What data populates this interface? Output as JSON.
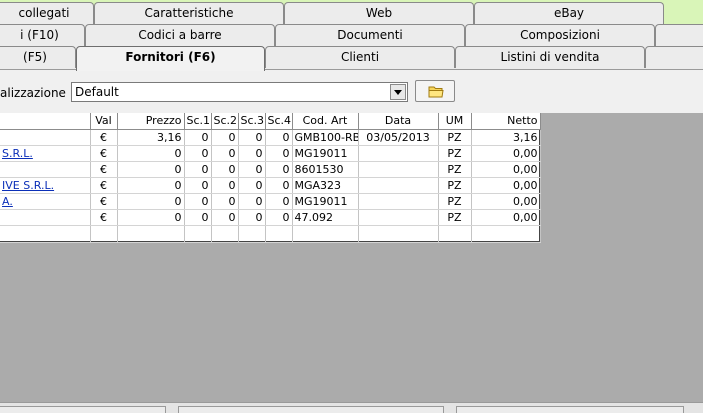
{
  "tabs": {
    "row1": [
      "collegati",
      "Caratteristiche",
      "Web",
      "eBay"
    ],
    "row2": [
      "i (F10)",
      "Codici a barre",
      "Documenti",
      "Composizioni"
    ],
    "row3": [
      "(F5)",
      "Fornitori (F6)",
      "Clienti",
      "Listini di vendita"
    ],
    "active": "Fornitori (F6)"
  },
  "layout": {
    "label": "alizzazione :",
    "value": "Default"
  },
  "icons": {
    "dropdown": "chevron-down-icon",
    "folder": "folder-icon"
  },
  "grid": {
    "columns": [
      "",
      "Val",
      "Prezzo",
      "Sc.1",
      "Sc.2",
      "Sc.3",
      "Sc.4",
      "Cod. Art",
      "Data",
      "UM",
      "Netto"
    ],
    "rows": [
      [
        "",
        "€",
        "3,16",
        "0",
        "0",
        "0",
        "0",
        "GMB100-RB",
        "03/05/2013",
        "PZ",
        "3,16"
      ],
      [
        "S.R.L.",
        "€",
        "0",
        "0",
        "0",
        "0",
        "0",
        "MG19011",
        "",
        "PZ",
        "0,00"
      ],
      [
        "",
        "€",
        "0",
        "0",
        "0",
        "0",
        "0",
        "8601530",
        "",
        "PZ",
        "0,00"
      ],
      [
        "IVE S.R.L.",
        "€",
        "0",
        "0",
        "0",
        "0",
        "0",
        "MGA323",
        "",
        "PZ",
        "0,00"
      ],
      [
        "A.",
        "€",
        "0",
        "0",
        "0",
        "0",
        "0",
        "MG19011",
        "",
        "PZ",
        "0,00"
      ],
      [
        "",
        "€",
        "0",
        "0",
        "0",
        "0",
        "0",
        "47.092",
        "",
        "PZ",
        "0,00"
      ]
    ],
    "link_rows": [
      1,
      2,
      3,
      4
    ]
  },
  "colors": {
    "accent": "#d9f5b8",
    "link": "#0b2fb8",
    "grid_background": "#ababab"
  }
}
